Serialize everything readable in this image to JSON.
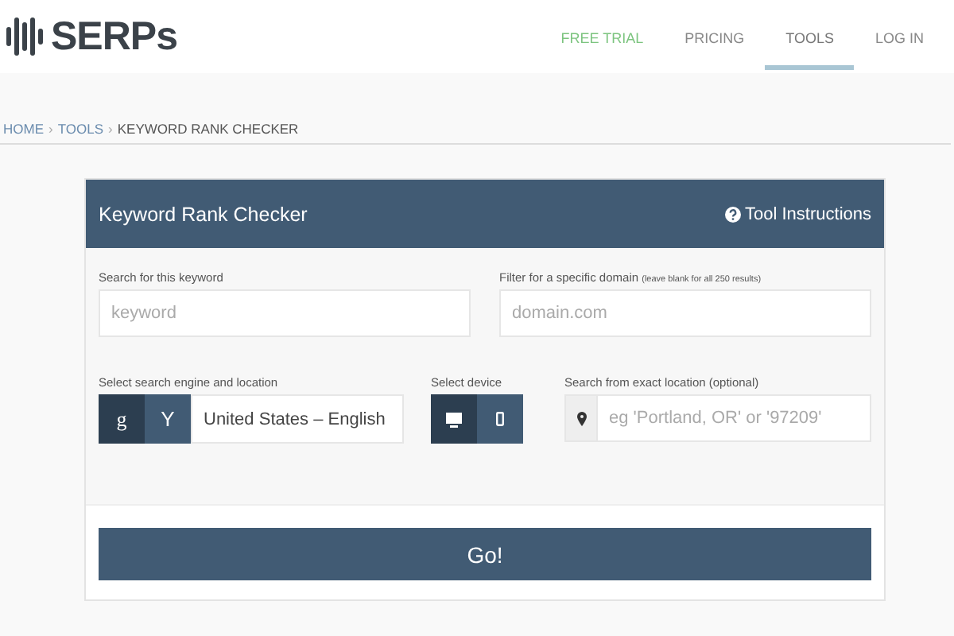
{
  "logo": {
    "text": "SERPs"
  },
  "nav": [
    {
      "label": "FREE TRIAL",
      "selected": false,
      "color": "#7cc47f"
    },
    {
      "label": "PRICING",
      "selected": false,
      "color": "#888888"
    },
    {
      "label": "TOOLS",
      "selected": true,
      "color": "#777777"
    },
    {
      "label": "LOG IN",
      "selected": false,
      "color": "#888888"
    }
  ],
  "breadcrumb": [
    {
      "label": "HOME",
      "link": true
    },
    {
      "label": "TOOLS",
      "link": true
    },
    {
      "label": "KEYWORD RANK CHECKER",
      "link": false
    }
  ],
  "breadcrumb_separator": "›",
  "panel": {
    "title": "Keyword Rank Checker",
    "help_link": "Tool Instructions",
    "keyword": {
      "label": "Search for this keyword",
      "placeholder": "keyword"
    },
    "domain": {
      "label": "Filter for a specific domain",
      "note": "(leave blank for all 250 results)",
      "placeholder": "domain.com"
    },
    "engine": {
      "label": "Select search engine and location",
      "options": [
        {
          "text": "g",
          "selected": true
        },
        {
          "text": "Y",
          "selected": false
        }
      ],
      "location": "United States – English"
    },
    "device": {
      "label": "Select device",
      "options": [
        {
          "kind": "desktop",
          "selected": true
        },
        {
          "kind": "mobile",
          "selected": false
        }
      ]
    },
    "exact_location": {
      "label": "Search from exact location (optional)",
      "placeholder": "eg 'Portland, OR' or '97209'"
    },
    "submit": "Go!"
  }
}
